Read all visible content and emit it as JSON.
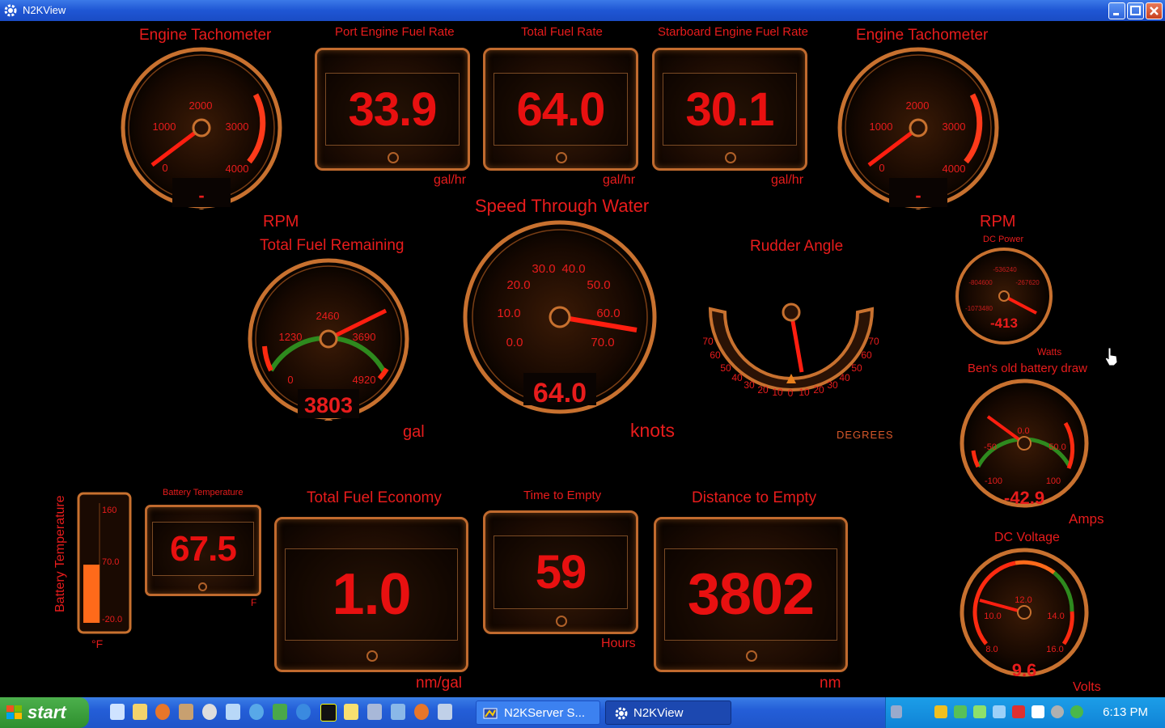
{
  "window": {
    "title": "N2KView"
  },
  "gauges": {
    "tach_left": {
      "title": "Engine Tachometer",
      "ticks": [
        "0",
        "1000",
        "2000",
        "3000",
        "4000"
      ],
      "readout": "-",
      "unit": "RPM"
    },
    "tach_right": {
      "title": "Engine Tachometer",
      "ticks": [
        "0",
        "1000",
        "2000",
        "3000",
        "4000"
      ],
      "readout": "-",
      "unit": "RPM"
    },
    "fuel_remaining": {
      "title": "Total Fuel Remaining",
      "ticks": [
        "0",
        "1230",
        "2460",
        "3690",
        "4920"
      ],
      "readout": "3803",
      "unit": "gal",
      "value": 3803
    },
    "speed": {
      "title": "Speed Through Water",
      "ticks": [
        "0.0",
        "10.0",
        "20.0",
        "30.0",
        "40.0",
        "50.0",
        "60.0",
        "70.0"
      ],
      "readout": "64.0",
      "unit": "knots",
      "value": 64.0
    },
    "rudder": {
      "title": "Rudder Angle",
      "left_ticks": [
        "70",
        "60",
        "50",
        "40",
        "30",
        "20",
        "10",
        "0"
      ],
      "right_ticks": [
        "10",
        "20",
        "30",
        "40",
        "50",
        "60",
        "70"
      ],
      "unit": "DEGREES"
    },
    "dc_power": {
      "title": "DC Power",
      "ticks": [
        "-1073480",
        "-804600",
        "-536240",
        "-267620"
      ],
      "readout": "-413",
      "unit": "Watts"
    },
    "battery_draw": {
      "title": "Ben's old battery draw",
      "ticks": [
        "-100",
        "-50",
        "0.0",
        "50.0",
        "100"
      ],
      "readout": "-42.9",
      "unit": "Amps",
      "value": -42.9
    },
    "dc_voltage": {
      "title": "DC Voltage",
      "ticks": [
        "8.0",
        "10.0",
        "12.0",
        "14.0",
        "16.0"
      ],
      "readout": "9.6",
      "unit": "Volts",
      "value": 9.6
    },
    "battery_temp_bar": {
      "title": "Battery Temperature",
      "ticks": [
        "160",
        "70.0",
        "-20.0"
      ],
      "unit": "°F",
      "value": 67.5
    }
  },
  "displays": {
    "port_fuel": {
      "title": "Port Engine Fuel Rate",
      "value": "33.9",
      "unit": "gal/hr"
    },
    "total_fuel": {
      "title": "Total Fuel Rate",
      "value": "64.0",
      "unit": "gal/hr"
    },
    "stbd_fuel": {
      "title": "Starboard Engine Fuel Rate",
      "value": "30.1",
      "unit": "gal/hr"
    },
    "battery_temp": {
      "title": "Battery Temperature",
      "value": "67.5",
      "unit": "F"
    },
    "fuel_economy": {
      "title": "Total Fuel Economy",
      "value": "1.0",
      "unit": "nm/gal"
    },
    "time_empty": {
      "title": "Time to Empty",
      "value": "59",
      "unit": "Hours"
    },
    "distance_empty": {
      "title": "Distance to Empty",
      "value": "3802",
      "unit": "nm"
    }
  },
  "taskbar": {
    "start_label": "start",
    "tasks": [
      "N2KServer S...",
      "N2KView"
    ],
    "clock": "6:13 PM"
  }
}
